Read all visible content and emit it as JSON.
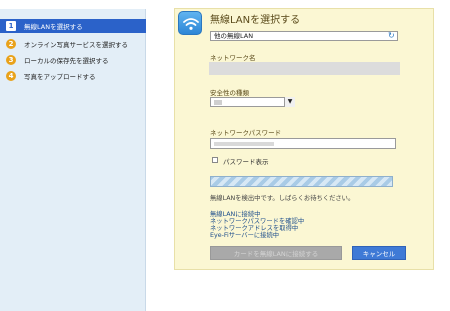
{
  "sidebar": {
    "steps": [
      {
        "number": "1",
        "label": "無線LANを選択する"
      },
      {
        "number": "2",
        "label": "オンライン写真サービスを選択する"
      },
      {
        "number": "3",
        "label": "ローカルの保存先を選択する"
      },
      {
        "number": "4",
        "label": "写真をアップロードする"
      }
    ],
    "active_step": 1
  },
  "panel": {
    "title": "無線LANを選択する",
    "network_select_value": "他の無線LAN",
    "network_name_label": "ネットワーク名",
    "security_type_label": "安全性の種類",
    "password_label": "ネットワークパスワード",
    "show_password_label": "パスワード表示",
    "show_password_checked": false,
    "waiting_message": "無線LANを検出中です。しばらくお待ちください。",
    "status_lines": [
      "無線LANに接続中",
      "ネットワークパスワードを確認中",
      "ネットワークアドレスを取得中",
      "Eye-Fiサーバーに接続中"
    ],
    "primary_button_label": "カードを無線LANに接続する",
    "cancel_button_label": "キャンセル"
  },
  "colors": {
    "active_step_bg": "#2b62c9",
    "step_badge": "#e9a21a",
    "panel_bg": "#fbf7d3",
    "status_text": "#1c4d8c",
    "cancel_button": "#3f7ad6"
  },
  "icons": {
    "panel_badge": "wifi-icon",
    "select_refresh": "refresh-icon",
    "dropdown": "chevron-down-icon"
  }
}
